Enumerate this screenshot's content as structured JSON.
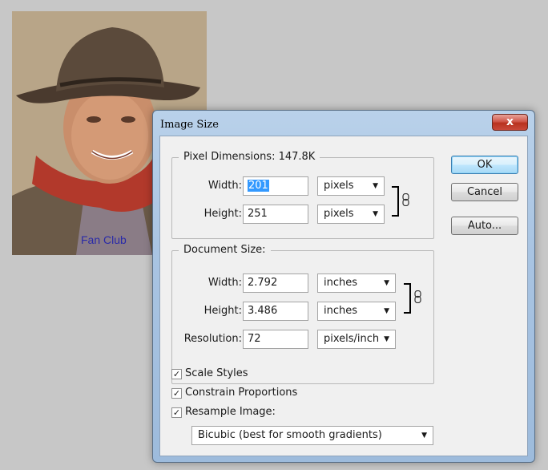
{
  "photo": {
    "watermark": "Fan Club"
  },
  "dialog": {
    "title": "Image Size",
    "close_label": "x",
    "buttons": {
      "ok": "OK",
      "cancel": "Cancel",
      "auto": "Auto..."
    },
    "pixel_dimensions": {
      "legend": "Pixel Dimensions:  147.8K",
      "width_label": "Width:",
      "width_value": "201",
      "width_unit": "pixels",
      "height_label": "Height:",
      "height_value": "251",
      "height_unit": "pixels"
    },
    "document_size": {
      "legend": "Document Size:",
      "width_label": "Width:",
      "width_value": "2.792",
      "width_unit": "inches",
      "height_label": "Height:",
      "height_value": "3.486",
      "height_unit": "inches",
      "resolution_label": "Resolution:",
      "resolution_value": "72",
      "resolution_unit": "pixels/inch"
    },
    "options": {
      "scale_styles": {
        "label": "Scale Styles",
        "checked": true
      },
      "constrain_proportions": {
        "label": "Constrain Proportions",
        "checked": true
      },
      "resample_image": {
        "label": "Resample Image:",
        "checked": true
      }
    },
    "resample_method": "Bicubic (best for smooth gradients)",
    "check_mark": "✓",
    "dropdown_arrow": "▼"
  }
}
